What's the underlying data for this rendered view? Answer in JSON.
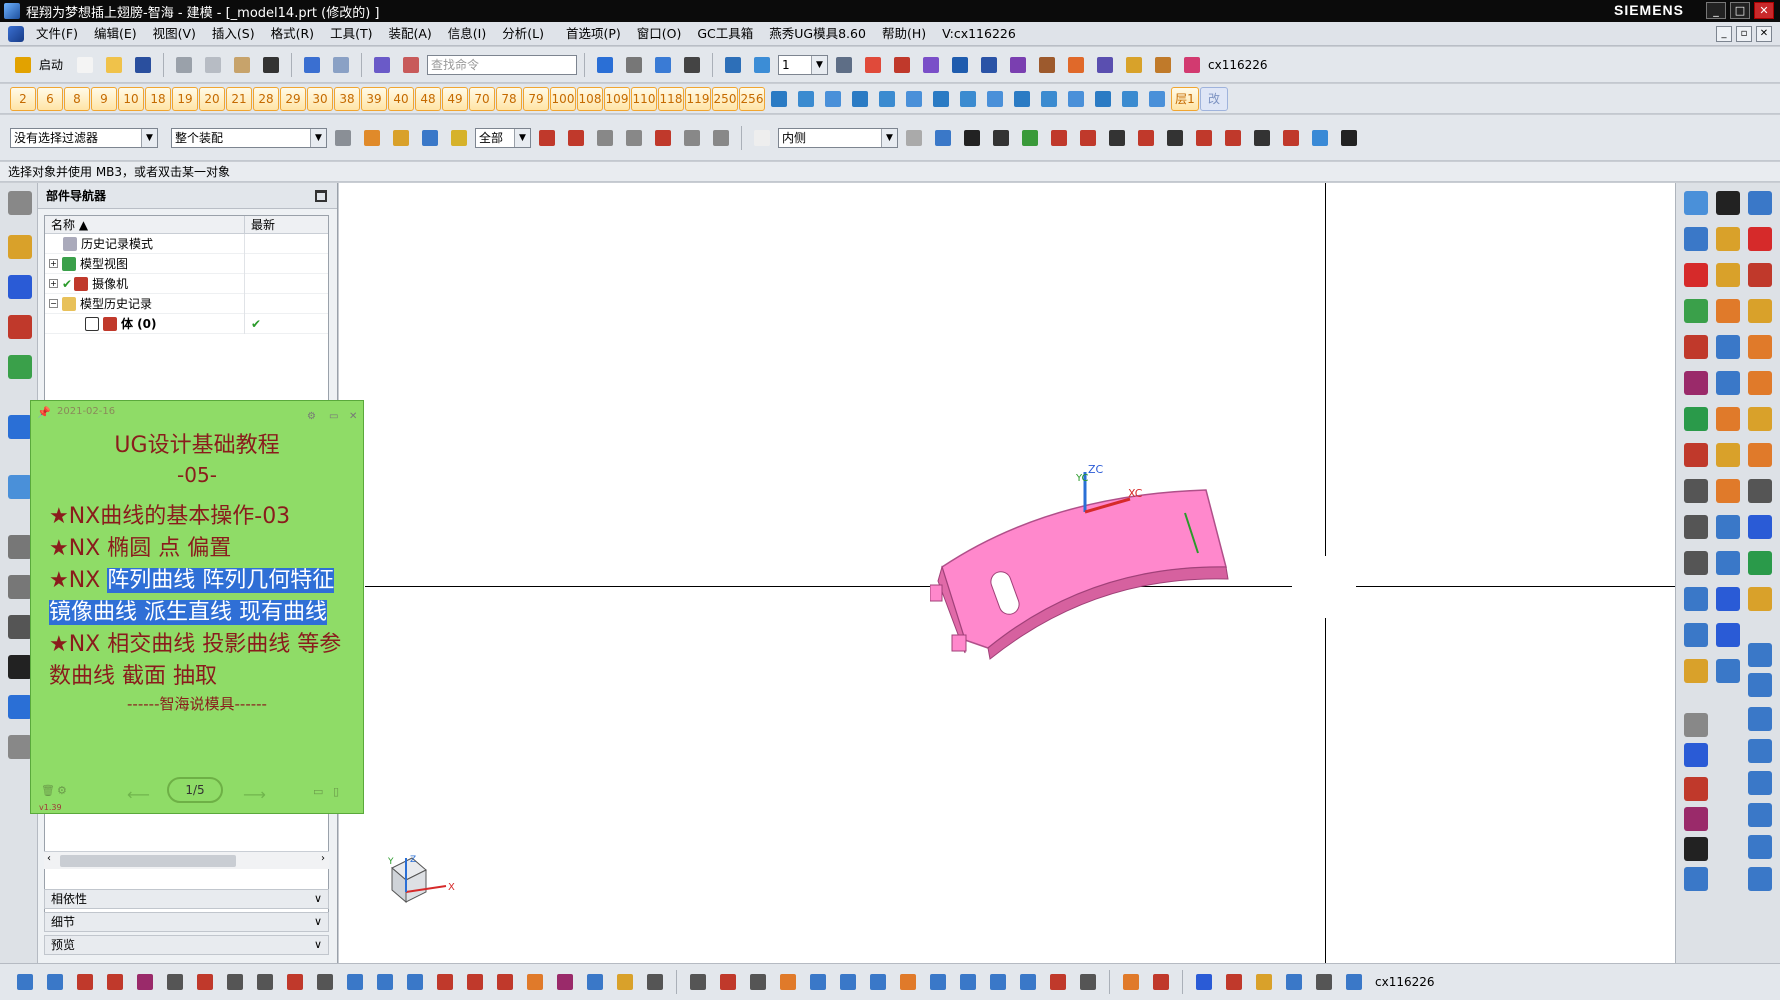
{
  "window": {
    "title": "程翔为梦想插上翅膀-智海 - 建模 - [_model14.prt (修改的) ]",
    "brand": "SIEMENS"
  },
  "menu": {
    "items": [
      "文件(F)",
      "编辑(E)",
      "视图(V)",
      "插入(S)",
      "格式(R)",
      "工具(T)",
      "装配(A)",
      "信息(I)",
      "分析(L)",
      "首选项(P)",
      "窗口(O)",
      "GC工具箱",
      "燕秀UG模具8.60",
      "帮助(H)",
      "V:cx116226"
    ]
  },
  "toolbar1": {
    "start_label": "启动",
    "search_placeholder": "查找命令",
    "layer_value": "1",
    "user_label": "cx116226"
  },
  "toolbar2": {
    "numbers": [
      "2",
      "6",
      "8",
      "9",
      "10",
      "18",
      "19",
      "20",
      "21",
      "28",
      "29",
      "30",
      "38",
      "39",
      "40",
      "48",
      "49",
      "70",
      "78",
      "79",
      "100",
      "108",
      "109",
      "110",
      "118",
      "119",
      "250",
      "256"
    ],
    "layer_btn": "层1",
    "change_btn": "改"
  },
  "toolbar3": {
    "filter_value": "没有选择过滤器",
    "assembly_value": "整个装配",
    "scope_value": "全部",
    "inside_value": "内侧"
  },
  "status": {
    "text": "选择对象并使用 MB3，或者双击某一对象"
  },
  "navigator": {
    "title": "部件导航器",
    "col_name": "名称",
    "col_latest": "最新",
    "rows": [
      {
        "label": "历史记录模式",
        "check": ""
      },
      {
        "label": "模型视图",
        "check": ""
      },
      {
        "label": "摄像机",
        "check": ""
      },
      {
        "label": "模型历史记录",
        "check": ""
      },
      {
        "label": "体 (0)",
        "check": "✔"
      }
    ],
    "sections": [
      "相依性",
      "细节",
      "预览"
    ]
  },
  "note": {
    "date": "2021-02-16",
    "title": "UG设计基础教程",
    "subtitle": "-05-",
    "line1": "★NX曲线的基本操作-03",
    "line2": "★NX  椭圆  点  偏置",
    "line3a": "★NX ",
    "line3b": "阵列曲线  阵列几何特征  镜像曲线  派生直线  现有曲线",
    "line4": "★NX  相交曲线  投影曲线  等参数曲线  截面  抽取",
    "footer": "------智海说模具------",
    "page": "1/5",
    "version": "v1.39"
  },
  "viewport": {
    "axis_zc": "ZC",
    "axis_yc": "YC",
    "axis_xc": "XC",
    "triad_x": "X",
    "triad_z": "Z",
    "triad_y": "Y"
  },
  "bottom": {
    "user_label": "cx116226"
  },
  "colors": {
    "part": "#ff88cc",
    "note_bg": "#8fdc67",
    "highlight": "#2f6fd6"
  }
}
